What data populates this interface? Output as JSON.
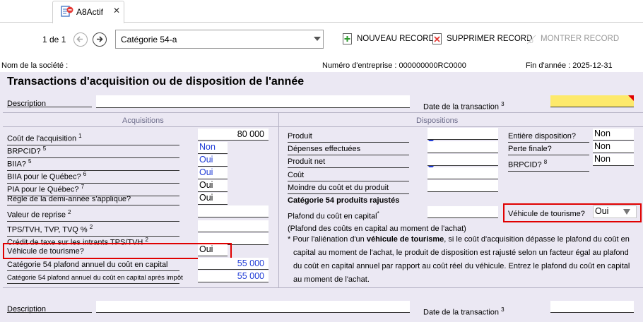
{
  "tab": {
    "title": "A8Actif",
    "close": "✕"
  },
  "toolbar": {
    "page_indicator": "1 de 1",
    "selected_category": "Catégorie 54-a",
    "new_record": "NOUVEAU RECORD",
    "delete_record": "SUPPRIMER RECORD",
    "show_record": "MONTRER RECORD"
  },
  "header": {
    "company": "Nom de la société :",
    "business_number": "Numéro d'entreprise : 000000000RC0000",
    "year_end": "Fin d'année : 2025-12-31"
  },
  "form": {
    "title": "Transactions d'acquisition ou de disposition de l'année",
    "description_label": "Description",
    "transaction_date_label": "Date de la transaction",
    "transaction_date_sup": "3",
    "acquisitions": {
      "heading": "Acquisitions",
      "cost_label": "Coût de l'acquisition",
      "cost_sup": "1",
      "cost_value": "80 000",
      "brpcid_label": "BRPCID?",
      "brpcid_sup": "5",
      "brpcid_value": "Non",
      "biia_label": "BIIA?",
      "biia_sup": "5",
      "biia_value": "Oui",
      "biia_qc_label": "BIIA pour le Québec?",
      "biia_qc_sup": "6",
      "biia_qc_value": "Oui",
      "pia_qc_label": "PIA pour le Québec?",
      "pia_qc_sup": "7",
      "pia_qc_value": "Oui",
      "half_year_label": "Règle de la demi-année s'applique?",
      "half_year_value": "Oui",
      "tradein_label": "Valeur de reprise",
      "tradein_sup": "2",
      "taxes_label": "TPS/TVH, TVP, TVQ %",
      "taxes_sup": "2",
      "itc_label": "Crédit de taxe sur les intrants TPS/TVH",
      "itc_sup": "2",
      "tourism_label": "Véhicule de tourisme?",
      "tourism_value": "Oui",
      "cap_label": "Catégorie 54 plafond annuel du coût en capital",
      "cap_value": "55 000",
      "cap_after_tax_label": "Catégorie 54 plafond annuel du coût en capital après impôt",
      "cap_after_tax_value": "55 000"
    },
    "dispositions": {
      "heading": "Dispositions",
      "proceeds_label": "Produit",
      "expenses_label": "Dépenses effectuées",
      "net_label": "Produit net",
      "cost_label": "Coût",
      "lesser_label": "Moindre du coût et du produit",
      "adjusted_heading": "Catégorie 54 produits rajustés",
      "cap_label": "Plafond du coût en capital",
      "cap_mark": "*",
      "full_disp_label": "Entière disposition?",
      "full_disp_value": "Non",
      "terminal_loss_label": "Perte finale?",
      "terminal_loss_value": "Non",
      "brpcid_label": "BRPCID?",
      "brpcid_sup": "8",
      "brpcid_value": "Non",
      "tourism_label": "Véhicule de tourisme?",
      "tourism_value": "Oui",
      "note1": "(Plafond des coûts en capital au moment de l'achat)",
      "note2_prefix": "* Pour l'aliénation d'un ",
      "note2_bold": "véhicule de tourisme",
      "note2_rest": ", si le coût d'acquisition dépasse le plafond du coût en",
      "note3": "capital au moment de l'achat, le produit de disposition est rajusté selon un facteur égal au plafond",
      "note4": "du coût en capital annuel par rapport au coût réel du véhicule. Entrez le plafond du coût en capital",
      "note5": "au moment de l'achat."
    },
    "record2": {
      "description_label": "Description",
      "transaction_date_label": "Date de la transaction",
      "transaction_date_sup": "3"
    }
  },
  "colors": {
    "accent_blue": "#1f3bd6",
    "form_bg": "#ebe8f3",
    "highlight_red": "#e00000",
    "date_yellow": "#fde96b"
  },
  "icons": [
    "document-icon",
    "back-arrow-icon",
    "forward-arrow-icon",
    "new-record-icon",
    "delete-record-icon",
    "show-record-icon",
    "dropdown-arrow-icon"
  ]
}
